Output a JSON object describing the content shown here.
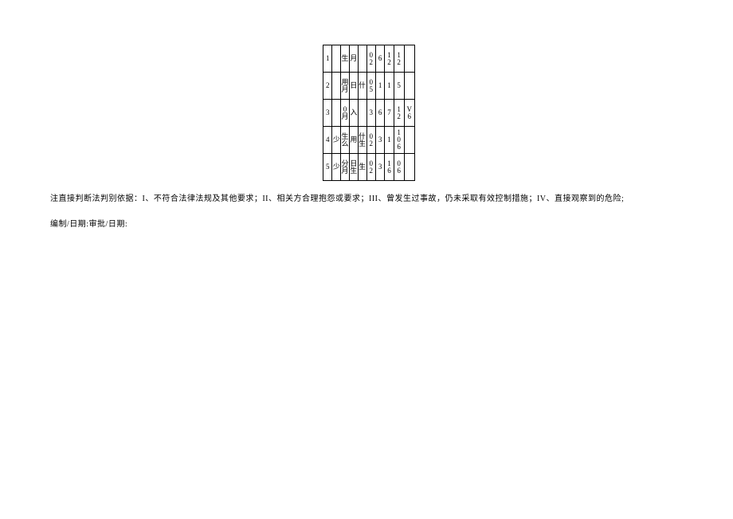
{
  "table": {
    "rows": [
      {
        "idx": "1",
        "a": "",
        "b": "生",
        "c": "月",
        "d": "",
        "e": "0,2",
        "f": "6",
        "g": "1,2",
        "h": "1,2",
        "i": ""
      },
      {
        "idx": "2",
        "a": "",
        "b": "用,月",
        "c": "日",
        "d": "什",
        "e": "0,5",
        "f": "1",
        "g": "1",
        "h": "5",
        "i": ""
      },
      {
        "idx": "3",
        "a": "",
        "b": "0,月",
        "c": "入",
        "d": "",
        "e": "3",
        "f": "6",
        "g": "7",
        "h": "1,2",
        "i": "V,6"
      },
      {
        "idx": "4",
        "a": "少",
        "b": "生,么",
        "c": "用",
        "d": "什,生",
        "e": "0,2",
        "f": "3",
        "g": "1",
        "h": "1,0,6",
        "i": ""
      },
      {
        "idx": "5",
        "a": "少",
        "b": "分,月",
        "c": "日,生",
        "d": "生",
        "e": "0,2",
        "f": "3",
        "g": "1,6",
        "h": "0,6",
        "i": ""
      }
    ]
  },
  "note": "注直接判断法判别依据：I、不符合法律法规及其他要求；II、相关方合理抱怨或要求；III、曾发生过事故，仍未采取有效控制措施；IV、直接观察到的危险;",
  "signature": "编制/日期:审批/日期:"
}
